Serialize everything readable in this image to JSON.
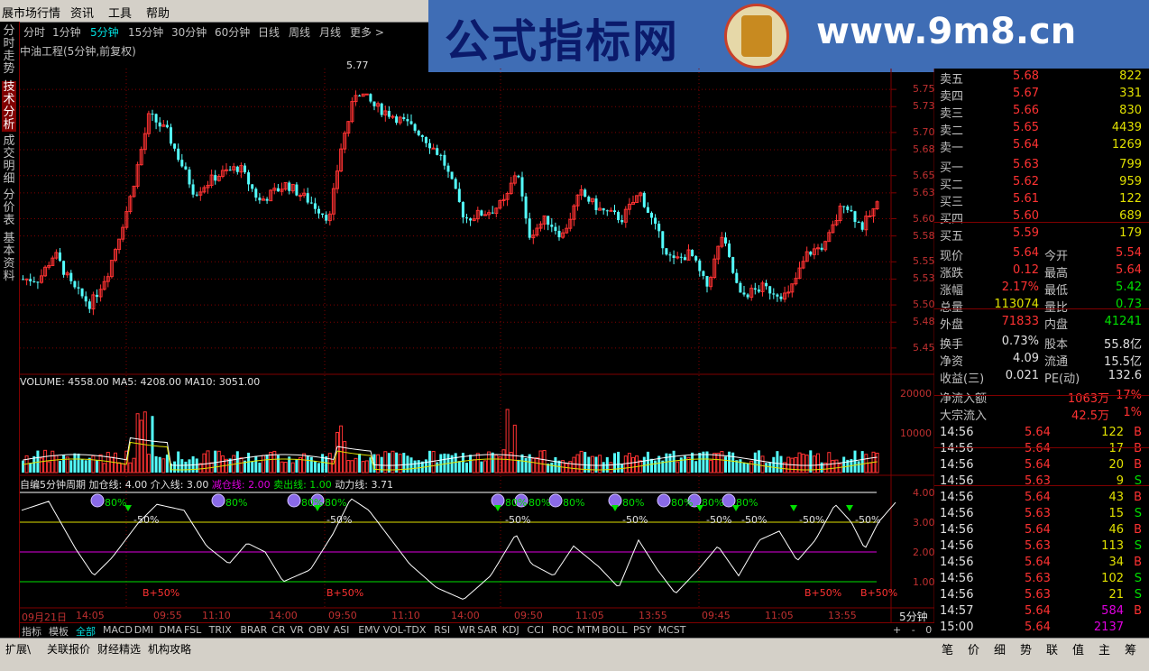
{
  "menu": {
    "items": [
      "展市场行情",
      "资讯",
      "工具",
      "帮助"
    ]
  },
  "banner": {
    "title": "公式指标网",
    "url": "www.9m8.cn"
  },
  "left_tabs": [
    "分时走势",
    "技术分析",
    "成交明细",
    "分价表",
    "基本资料"
  ],
  "periods": [
    "分时",
    "1分钟",
    "5分钟",
    "15分钟",
    "30分钟",
    "60分钟",
    "日线",
    "周线",
    "月线",
    "更多 >"
  ],
  "active_period": "5分钟",
  "stock_title": "中油工程(5分钟,前复权)",
  "max_label": "5.77",
  "price_axis": [
    "5.75",
    "5.73",
    "5.70",
    "5.68",
    "5.65",
    "5.63",
    "5.60",
    "5.58",
    "5.55",
    "5.53",
    "5.50",
    "5.48",
    "5.45"
  ],
  "volume_line": {
    "VOLUME": "VOLUME: 4558.00",
    "MA5": "MA5: 4208.00",
    "MA10": "MA10: 3051.00"
  },
  "volume_axis": [
    "20000",
    "10000"
  ],
  "indicator_line": {
    "name": "自编5分钟周期",
    "a": "加仓线: 4.00",
    "b": "介入线: 3.00",
    "c": "减仓线: 2.00",
    "d": "卖出线: 1.00",
    "e": "动力线: 3.71"
  },
  "ind_axis": [
    "4.00",
    "3.00",
    "2.00",
    "1.00"
  ],
  "ind_marks": {
    "p80": "80%",
    "m50": "-50%",
    "b50": "B+50%"
  },
  "time_axis": [
    "09月21日",
    "14:05",
    "09:55",
    "11:10",
    "14:00",
    "09:50",
    "11:10",
    "14:00",
    "09:50",
    "11:05",
    "13:55",
    "09:45",
    "11:05",
    "13:55"
  ],
  "period_label": "5分钟",
  "bottom_tabs": [
    "指标",
    "模板",
    "全部",
    "MACD",
    "DMI",
    "DMA",
    "FSL",
    "TRIX",
    "BRAR",
    "CR",
    "VR",
    "OBV",
    "ASI",
    "EMV",
    "VOL-TDX",
    "RSI",
    "WR",
    "SAR",
    "KDJ",
    "CCI",
    "ROC",
    "MTM",
    "BOLL",
    "PSY",
    "MCST"
  ],
  "bottom_right": [
    "+",
    "-",
    "0"
  ],
  "status_tabs": [
    "扩展\\",
    "关联报价",
    "财经精选",
    "机构攻略"
  ],
  "right_tabs": [
    "笔",
    "价",
    "细",
    "势",
    "联",
    "值",
    "主",
    "筹"
  ],
  "quote": {
    "sell": [
      {
        "l": "卖五",
        "p": "5.68",
        "v": "822"
      },
      {
        "l": "卖四",
        "p": "5.67",
        "v": "331"
      },
      {
        "l": "卖三",
        "p": "5.66",
        "v": "830"
      },
      {
        "l": "卖二",
        "p": "5.65",
        "v": "4439"
      },
      {
        "l": "卖一",
        "p": "5.64",
        "v": "1269"
      }
    ],
    "buy": [
      {
        "l": "买一",
        "p": "5.63",
        "v": "799"
      },
      {
        "l": "买二",
        "p": "5.62",
        "v": "959"
      },
      {
        "l": "买三",
        "p": "5.61",
        "v": "122"
      },
      {
        "l": "买四",
        "p": "5.60",
        "v": "689"
      },
      {
        "l": "买五",
        "p": "5.59",
        "v": "179"
      }
    ],
    "stats": [
      {
        "a": "现价",
        "av": "5.64",
        "b": "今开",
        "bv": "5.54"
      },
      {
        "a": "涨跌",
        "av": "0.12",
        "b": "最高",
        "bv": "5.64"
      },
      {
        "a": "涨幅",
        "av": "2.17%",
        "b": "最低",
        "bv": "5.42"
      },
      {
        "a": "总量",
        "av": "113074",
        "b": "量比",
        "bv": "0.73"
      },
      {
        "a": "外盘",
        "av": "71833",
        "b": "内盘",
        "bv": "41241"
      }
    ],
    "stats2": [
      {
        "a": "换手",
        "av": "0.73%",
        "b": "股本",
        "bv": "55.8亿"
      },
      {
        "a": "净资",
        "av": "4.09",
        "b": "流通",
        "bv": "15.5亿"
      },
      {
        "a": "收益(三)",
        "av": "0.021",
        "b": "PE(动)",
        "bv": "132.6"
      }
    ],
    "flow": [
      {
        "a": "净流入额",
        "av": "1063万",
        "bv": "17%"
      },
      {
        "a": "大宗流入",
        "av": "42.5万",
        "bv": "1%"
      }
    ],
    "ticks": [
      {
        "t": "14:56",
        "p": "5.64",
        "v": "122",
        "s": "B"
      },
      {
        "t": "14:56",
        "p": "5.64",
        "v": "17",
        "s": "B"
      },
      {
        "t": "14:56",
        "p": "5.64",
        "v": "20",
        "s": "B"
      },
      {
        "t": "14:56",
        "p": "5.63",
        "v": "9",
        "s": "S"
      },
      {
        "t": "14:56",
        "p": "5.64",
        "v": "43",
        "s": "B"
      },
      {
        "t": "14:56",
        "p": "5.63",
        "v": "15",
        "s": "S"
      },
      {
        "t": "14:56",
        "p": "5.64",
        "v": "46",
        "s": "B"
      },
      {
        "t": "14:56",
        "p": "5.63",
        "v": "113",
        "s": "S"
      },
      {
        "t": "14:56",
        "p": "5.64",
        "v": "34",
        "s": "B"
      },
      {
        "t": "14:56",
        "p": "5.63",
        "v": "102",
        "s": "S"
      },
      {
        "t": "14:56",
        "p": "5.63",
        "v": "21",
        "s": "S"
      },
      {
        "t": "14:57",
        "p": "5.64",
        "v": "584",
        "s": "B"
      },
      {
        "t": "15:00",
        "p": "5.64",
        "v": "2137",
        "s": ""
      }
    ]
  },
  "colors": {
    "up": "#ff3232",
    "down": "#54ffff",
    "grid": "#800000",
    "bg": "#000000"
  }
}
